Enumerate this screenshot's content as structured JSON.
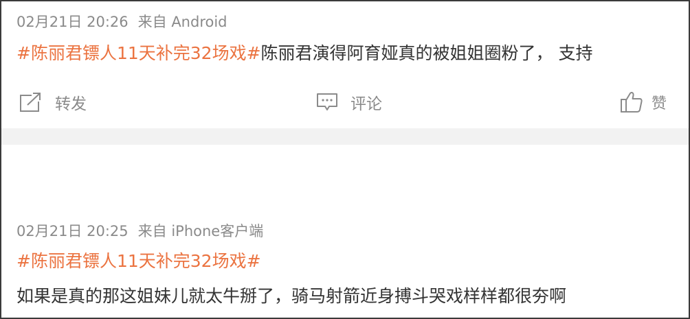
{
  "posts": [
    {
      "time": "02月21日 20:26",
      "source": "来自 Android",
      "hashtag": "#陈丽君镖人11天补完32场戏#",
      "text": "陈丽君演得阿育娅真的被姐姐圈粉了， 支持",
      "actions": {
        "repost_label": "转发",
        "comment_label": "评论",
        "like_label": "赞"
      }
    },
    {
      "time": "02月21日 20:25",
      "source": "来自 iPhone客户端",
      "hashtag": "#陈丽君镖人11天补完32场戏#",
      "text": "如果是真的那这姐妹儿就太牛掰了，骑马射箭近身搏斗哭戏样样都很夯啊"
    }
  ],
  "icons": {
    "repost": "share-icon",
    "comment": "comment-icon",
    "like": "thumbs-up-icon"
  },
  "colors": {
    "hashtag": "#eb7340",
    "meta": "#8a8a8a",
    "text": "#333333",
    "separator": "#f2f2f2"
  }
}
